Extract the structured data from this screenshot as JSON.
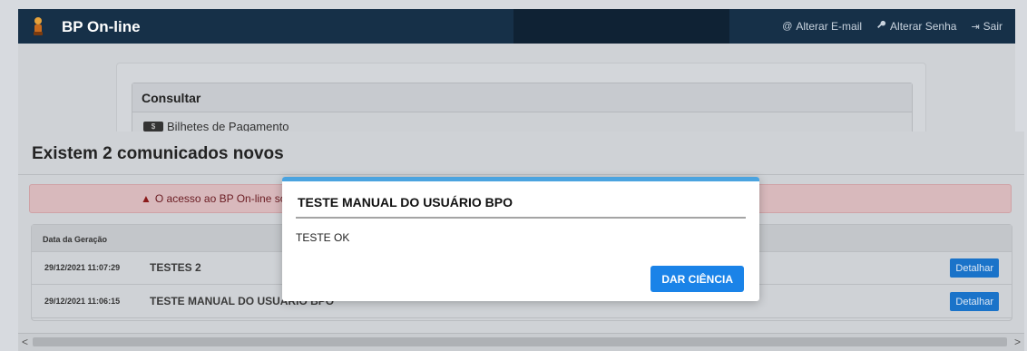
{
  "navbar": {
    "brand": "BP On-line",
    "links": [
      {
        "icon": "at-icon",
        "glyph": "@",
        "label": "Alterar E-mail"
      },
      {
        "icon": "key-icon",
        "glyph": "🔑",
        "label": "Alterar Senha"
      },
      {
        "icon": "sign-out-icon",
        "glyph": "⇥",
        "label": "Sair"
      }
    ]
  },
  "consultar": {
    "heading": "Consultar",
    "item": "Bilhetes de Pagamento"
  },
  "comunicados": {
    "title": "Existem 2 comunicados novos",
    "alert": "O acesso ao BP On-line só ocorrerá ap",
    "table": {
      "header": "Data da Geração",
      "rows": [
        {
          "date": "29/12/2021 11:07:29",
          "subject": "TESTES 2",
          "action": "Detalhar"
        },
        {
          "date": "29/12/2021 11:06:15",
          "subject": "TESTE MANUAL DO USUÁRIO BPO",
          "action": "Detalhar"
        }
      ]
    }
  },
  "dialog": {
    "title": "TESTE MANUAL DO USUÁRIO BPO",
    "body": "TESTE OK",
    "button": "DAR CIÊNCIA"
  },
  "colors": {
    "navbar": "#163048",
    "primary_button": "#1a83e8",
    "dialog_accent": "#4aa3df",
    "alert_bg": "#d8b9bc"
  }
}
